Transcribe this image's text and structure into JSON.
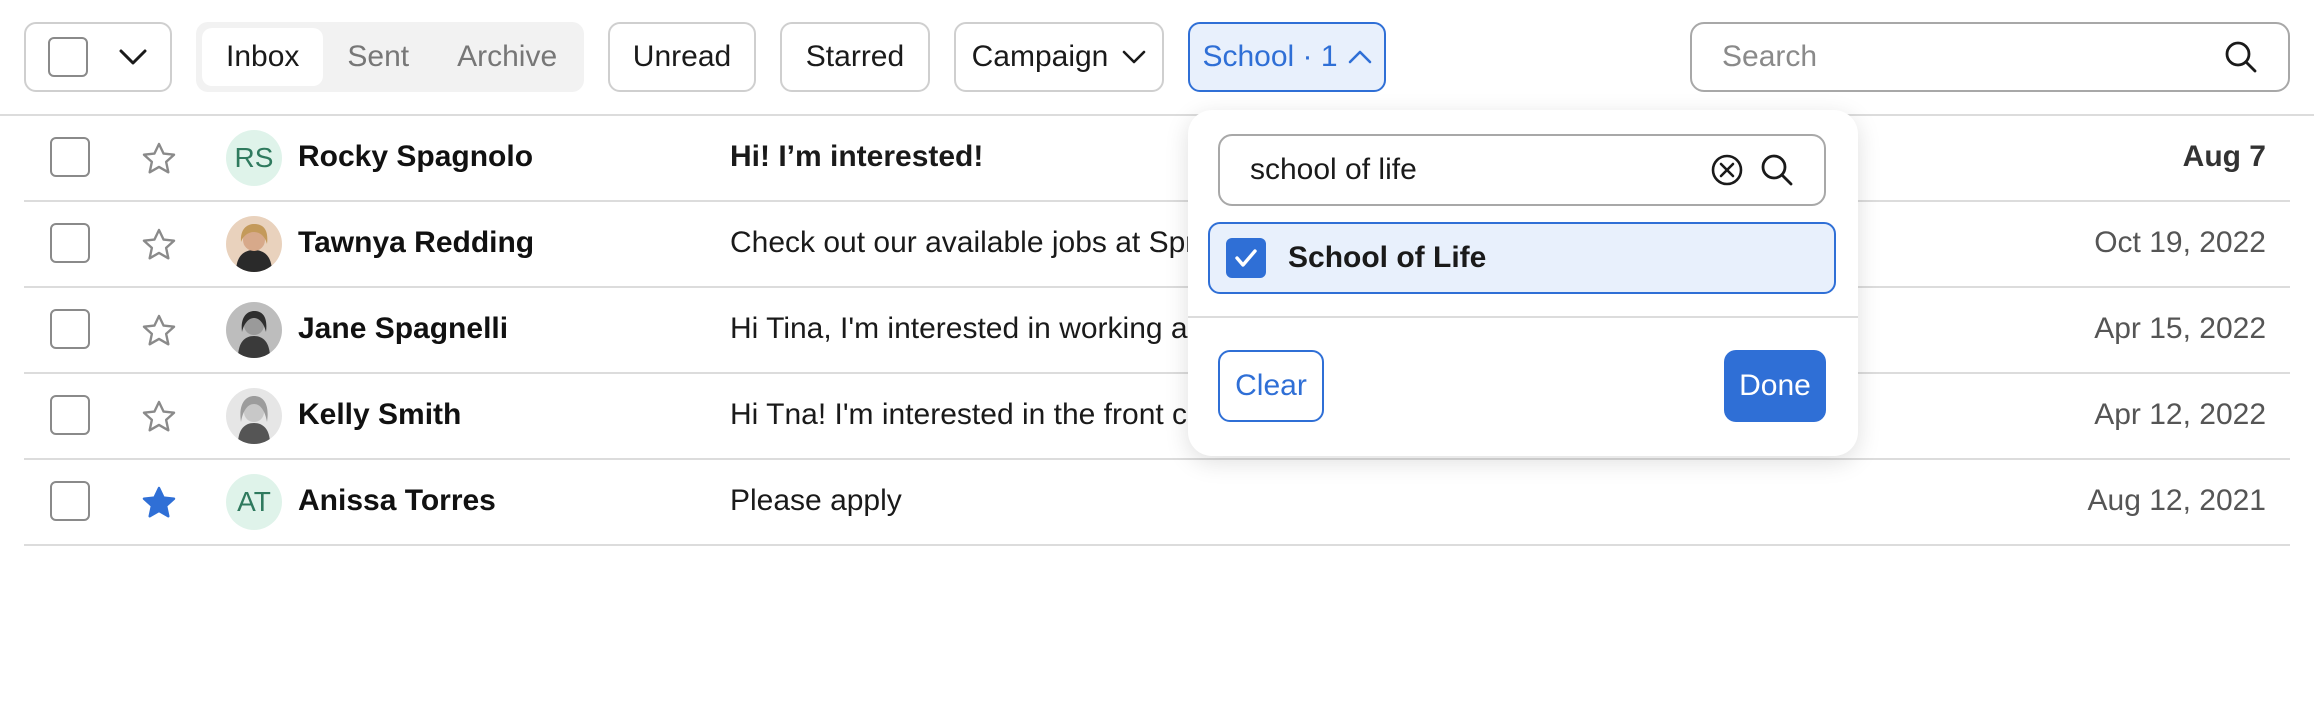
{
  "toolbar": {
    "tabs": [
      {
        "label": "Inbox",
        "active": true
      },
      {
        "label": "Sent",
        "active": false
      },
      {
        "label": "Archive",
        "active": false
      }
    ],
    "unread_label": "Unread",
    "starred_label": "Starred",
    "campaign_label": "Campaign",
    "school_label": "School · 1",
    "search_placeholder": "Search"
  },
  "rows": [
    {
      "initials": "RS",
      "avatar_type": "initials",
      "name": "Rocky Spagnolo",
      "subject": "Hi! I’m interested!",
      "date": "Aug 7",
      "starred": false,
      "unread": true
    },
    {
      "initials": "",
      "avatar_type": "photo",
      "name": "Tawnya Redding",
      "subject": "Check out our available jobs at Sprin",
      "date": "Oct 19, 2022",
      "starred": false,
      "unread": false
    },
    {
      "initials": "",
      "avatar_type": "photo",
      "name": "Jane Spagnelli",
      "subject": "Hi Tina, I'm interested in working at S",
      "date": "Apr 15, 2022",
      "starred": false,
      "unread": false
    },
    {
      "initials": "",
      "avatar_type": "photo",
      "name": "Kelly Smith",
      "subject": "Hi Tna! I'm interested in the front cou",
      "date": "Apr 12, 2022",
      "starred": false,
      "unread": false
    },
    {
      "initials": "AT",
      "avatar_type": "initials",
      "name": "Anissa Torres",
      "subject": "Please apply",
      "date": "Aug 12, 2021",
      "starred": true,
      "unread": false
    }
  ],
  "dropdown": {
    "search_value": "school of life",
    "option_label": "School of Life",
    "option_checked": true,
    "clear_label": "Clear",
    "done_label": "Done"
  },
  "colors": {
    "accent": "#2f6fd6",
    "accent_bg": "#e8f0fc",
    "avatar_bg": "#dff3ea",
    "avatar_fg": "#2f7a5e"
  }
}
